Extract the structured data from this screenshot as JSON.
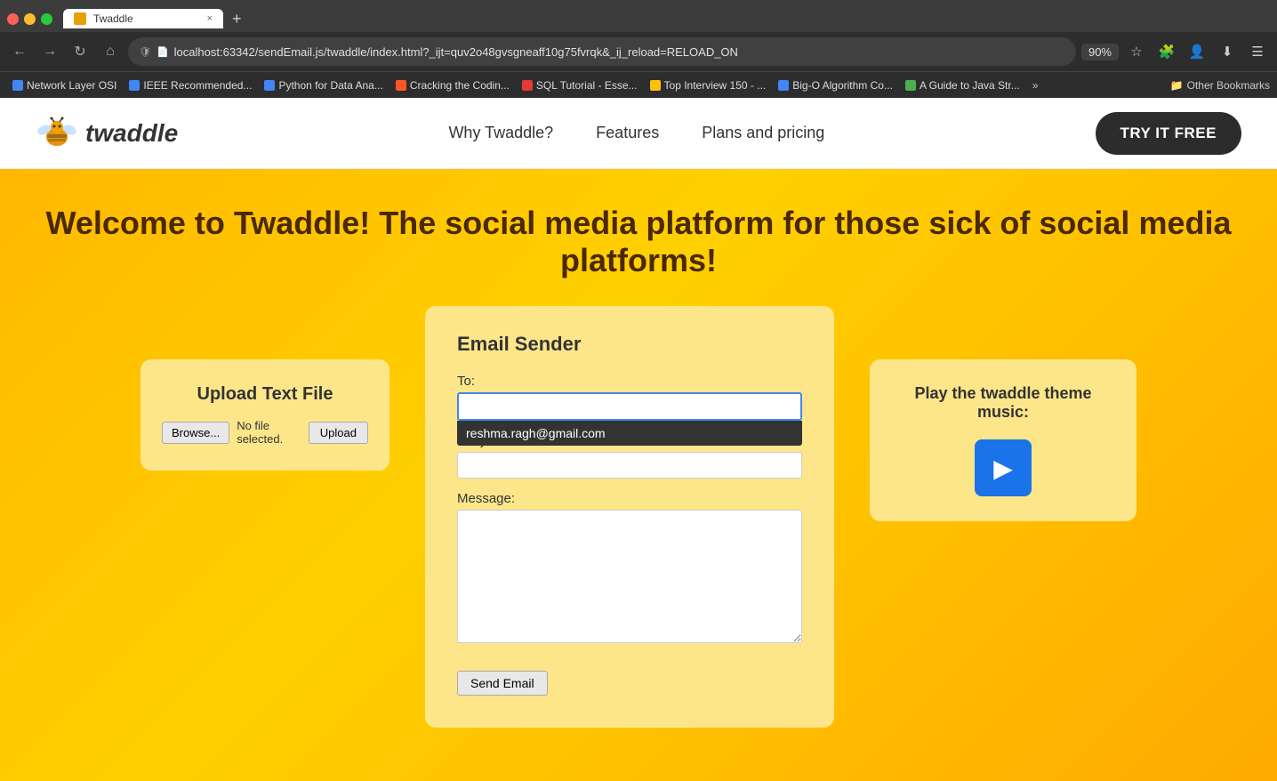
{
  "browser": {
    "window_controls": {
      "close": "●",
      "minimize": "●",
      "maximize": "●"
    },
    "tab": {
      "favicon_alt": "Twaddle favicon",
      "label": "Twaddle",
      "close": "×"
    },
    "tab_new": "+",
    "address_bar": {
      "url": "localhost:63342/sendEmail.js/twaddle/index.html?_ijt=quv2o48gvsgneaff10g75fvrqk&_ij_reload=RELOAD_ON",
      "security_icon": "🔒",
      "zoom": "90%"
    },
    "bookmarks": [
      {
        "label": "Network Layer OSI",
        "color": "bm-blue"
      },
      {
        "label": "IEEE Recommended...",
        "color": "bm-blue"
      },
      {
        "label": "Python for Data Ana...",
        "color": "bm-blue"
      },
      {
        "label": "Cracking the Codin...",
        "color": "bm-flame"
      },
      {
        "label": "SQL Tutorial - Esse...",
        "color": "bm-red"
      },
      {
        "label": "Top Interview 150 - ...",
        "color": "bm-yellow"
      },
      {
        "label": "Big-O Algorithm Co...",
        "color": "bm-blue"
      },
      {
        "label": "A Guide to Java Str...",
        "color": "bm-green"
      }
    ],
    "more_bookmarks": "»",
    "other_bookmarks_label": "Other Bookmarks"
  },
  "site": {
    "logo_text": "twaddle",
    "nav": {
      "why_label": "Why Twaddle?",
      "features_label": "Features",
      "pricing_label": "Plans and pricing",
      "try_free_label": "TRY IT FREE"
    },
    "hero": {
      "title": "Welcome to Twaddle! The social media platform for those sick of social media platforms!"
    },
    "upload_box": {
      "title": "Upload Text File",
      "browse_label": "Browse...",
      "no_file_label": "No file selected.",
      "upload_label": "Upload"
    },
    "email_form": {
      "title": "Email Sender",
      "to_label": "To:",
      "to_placeholder": "",
      "autocomplete_email": "reshma.ragh@gmail.com",
      "subject_label": "Subject:",
      "message_label": "Message:",
      "send_label": "Send Email"
    },
    "music_box": {
      "title": "Play the twaddle theme music:",
      "play_icon": "▶"
    }
  }
}
